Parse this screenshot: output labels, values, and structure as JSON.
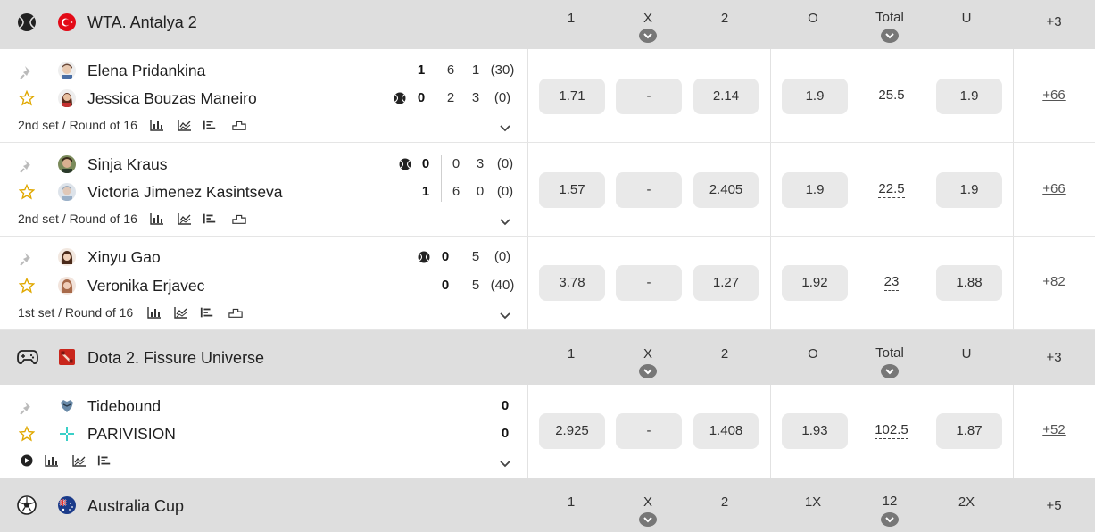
{
  "headers_a": {
    "c1": "1",
    "cx": "X",
    "c2": "2",
    "o": "O",
    "total": "Total",
    "u": "U"
  },
  "headers_c": {
    "c1": "1",
    "cx": "X",
    "c2": "2",
    "o": "1X",
    "total": "12",
    "u": "2X"
  },
  "leagues": [
    {
      "name": "WTA. Antalya 2",
      "sport_icon": "tennis-ball-icon",
      "flag": "turkey-flag-icon",
      "more": "+3"
    },
    {
      "name": "Dota 2. Fissure Universe",
      "sport_icon": "gamepad-icon",
      "flag": "dota2-logo-icon",
      "more": "+3"
    },
    {
      "name": "Australia Cup",
      "sport_icon": "soccer-ball-icon",
      "flag": "australia-flag-icon",
      "more": "+5"
    }
  ],
  "matches": [
    {
      "home": {
        "name": "Elena Pridankina",
        "main": "1",
        "s1": "6",
        "s2": "1",
        "game": "(30)"
      },
      "away": {
        "name": "Jessica Bouzas Maneiro",
        "main": "0",
        "s1": "2",
        "s2": "3",
        "game": "(0)"
      },
      "info": "2nd set / Round of 16",
      "odds": {
        "w1": "1.71",
        "x": "-",
        "w2": "2.14",
        "over": "1.9",
        "total": "25.5",
        "under": "1.9",
        "more": "+66"
      }
    },
    {
      "home": {
        "name": "Sinja Kraus",
        "main": "0",
        "s1": "0",
        "s2": "3",
        "game": "(0)"
      },
      "away": {
        "name": "Victoria Jimenez Kasintseva",
        "main": "1",
        "s1": "6",
        "s2": "0",
        "game": "(0)"
      },
      "info": "2nd set / Round of 16",
      "odds": {
        "w1": "1.57",
        "x": "-",
        "w2": "2.405",
        "over": "1.9",
        "total": "22.5",
        "under": "1.9",
        "more": "+66"
      }
    },
    {
      "home": {
        "name": "Xinyu Gao",
        "main": "0",
        "s1": "5",
        "game": "(0)"
      },
      "away": {
        "name": "Veronika Erjavec",
        "main": "0",
        "s1": "5",
        "game": "(40)"
      },
      "info": "1st set / Round of 16",
      "odds": {
        "w1": "3.78",
        "x": "-",
        "w2": "1.27",
        "over": "1.92",
        "total": "23",
        "under": "1.88",
        "more": "+82"
      }
    },
    {
      "home": {
        "name": "Tidebound",
        "main": "0"
      },
      "away": {
        "name": "PARIVISION",
        "main": "0"
      },
      "odds": {
        "w1": "2.925",
        "x": "-",
        "w2": "1.408",
        "over": "1.93",
        "total": "102.5",
        "under": "1.87",
        "more": "+52"
      }
    }
  ],
  "colors": {
    "header_bg": "#dedede",
    "odd_bg": "#e9e9e9",
    "star": "#e0a800",
    "pin": "#bbbbbb"
  }
}
